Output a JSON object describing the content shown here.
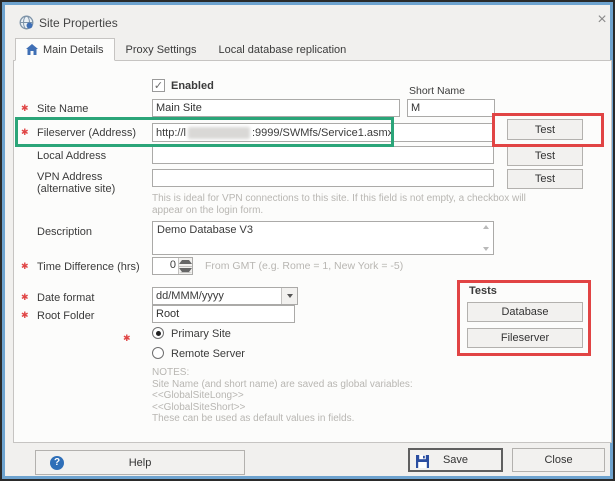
{
  "window": {
    "title": "Site Properties",
    "close_glyph": "×"
  },
  "tabs": {
    "main": "Main Details",
    "proxy": "Proxy Settings",
    "replication": "Local database replication"
  },
  "required_marker": "✱",
  "form": {
    "enabled": {
      "label": "Enabled",
      "check_glyph": "✓"
    },
    "short_name": {
      "label": "Short Name",
      "value": "M"
    },
    "site_name": {
      "label": "Site Name",
      "value": "Main Site"
    },
    "fileserver": {
      "label": "Fileserver (Address)",
      "url_prefix": "http://l",
      "url_suffix": ":9999/SWMfs/Service1.asmx"
    },
    "local_address": {
      "label": "Local Address"
    },
    "vpn": {
      "label1": "VPN Address",
      "label2": "(alternative site)",
      "help": "This is ideal for VPN connections to this site. If this field is not empty,  a checkbox will appear on the login form."
    },
    "test_button": "Test",
    "description": {
      "label": "Description",
      "value": "Demo Database V3"
    },
    "time_diff": {
      "label": "Time Difference (hrs)",
      "value": "0",
      "hint": "From GMT (e.g. Rome = 1, New York = -5)"
    },
    "date_format": {
      "label": "Date format",
      "value": "dd/MMM/yyyy"
    },
    "root_folder": {
      "label": "Root Folder",
      "value": "Root"
    },
    "site_type": {
      "primary_label": "Primary Site",
      "remote_label": "Remote Server"
    },
    "notes": {
      "l1": "NOTES:",
      "l2": "Site Name (and short name) are saved as global variables:",
      "l3": "<<GlobalSiteLong>>",
      "l4": "<<GlobalSiteShort>>",
      "l5": "These can be used as default values in fields."
    }
  },
  "tests_panel": {
    "title": "Tests",
    "database": "Database",
    "fileserver": "Fileserver"
  },
  "footer": {
    "help": "Help",
    "save": "Save",
    "close": "Close"
  },
  "colors": {
    "annotation_green": "#2ba579",
    "annotation_red": "#e14444",
    "window_border_blue": "#6ea3cf"
  }
}
